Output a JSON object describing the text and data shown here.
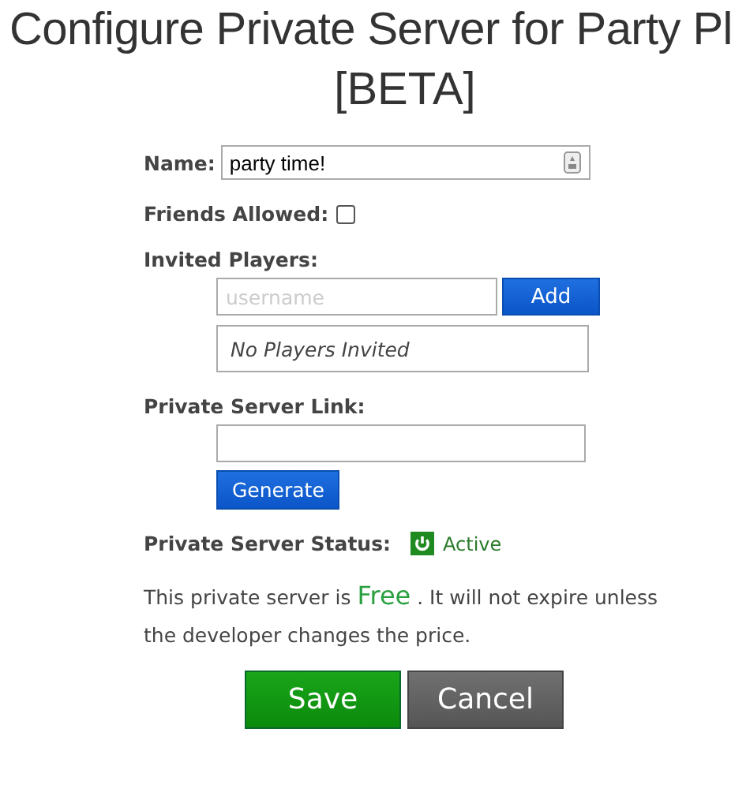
{
  "title": {
    "line1": "Configure Private Server for Party Pl",
    "line2": "[BETA]"
  },
  "name_field": {
    "label": "Name:",
    "value": "party time!"
  },
  "friends_allowed": {
    "label": "Friends Allowed:",
    "checked": false
  },
  "invited_players": {
    "label": "Invited Players:",
    "placeholder": "username",
    "add_button": "Add",
    "empty_text": "No Players Invited"
  },
  "private_server_link": {
    "label": "Private Server Link:",
    "generate_button": "Generate"
  },
  "status": {
    "label": "Private Server Status:",
    "active": true,
    "text": "Active"
  },
  "price_note": {
    "before": "This private server is",
    "price": "Free",
    "after": ". It will not expire unless the developer changes the price."
  },
  "buttons": {
    "save": "Save",
    "cancel": "Cancel"
  }
}
